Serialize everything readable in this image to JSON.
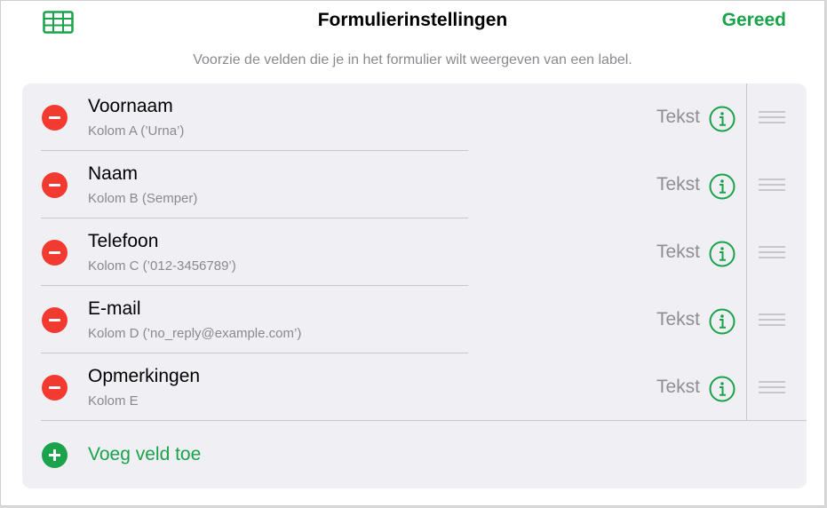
{
  "header": {
    "title": "Formulierinstellingen",
    "done_label": "Gereed",
    "table_icon": "table-grid-icon"
  },
  "subtitle": "Voorzie de velden die je in het formulier wilt weergeven van een label.",
  "fields": [
    {
      "name": "Voornaam",
      "column": "Kolom A (’Urna’)",
      "type": "Tekst"
    },
    {
      "name": "Naam",
      "column": "Kolom B (Semper)",
      "type": "Tekst"
    },
    {
      "name": "Telefoon",
      "column": "Kolom C (’012-3456789’)",
      "type": "Tekst"
    },
    {
      "name": "E-mail",
      "column": "Kolom D (’no_reply@example.com’)",
      "type": "Tekst"
    },
    {
      "name": "Opmerkingen",
      "column": "Kolom E",
      "type": "Tekst"
    }
  ],
  "add_field_label": "Voeg veld toe",
  "colors": {
    "accent_green": "#1aa34a",
    "delete_red": "#f23a30",
    "card_bg": "#efeff4"
  }
}
